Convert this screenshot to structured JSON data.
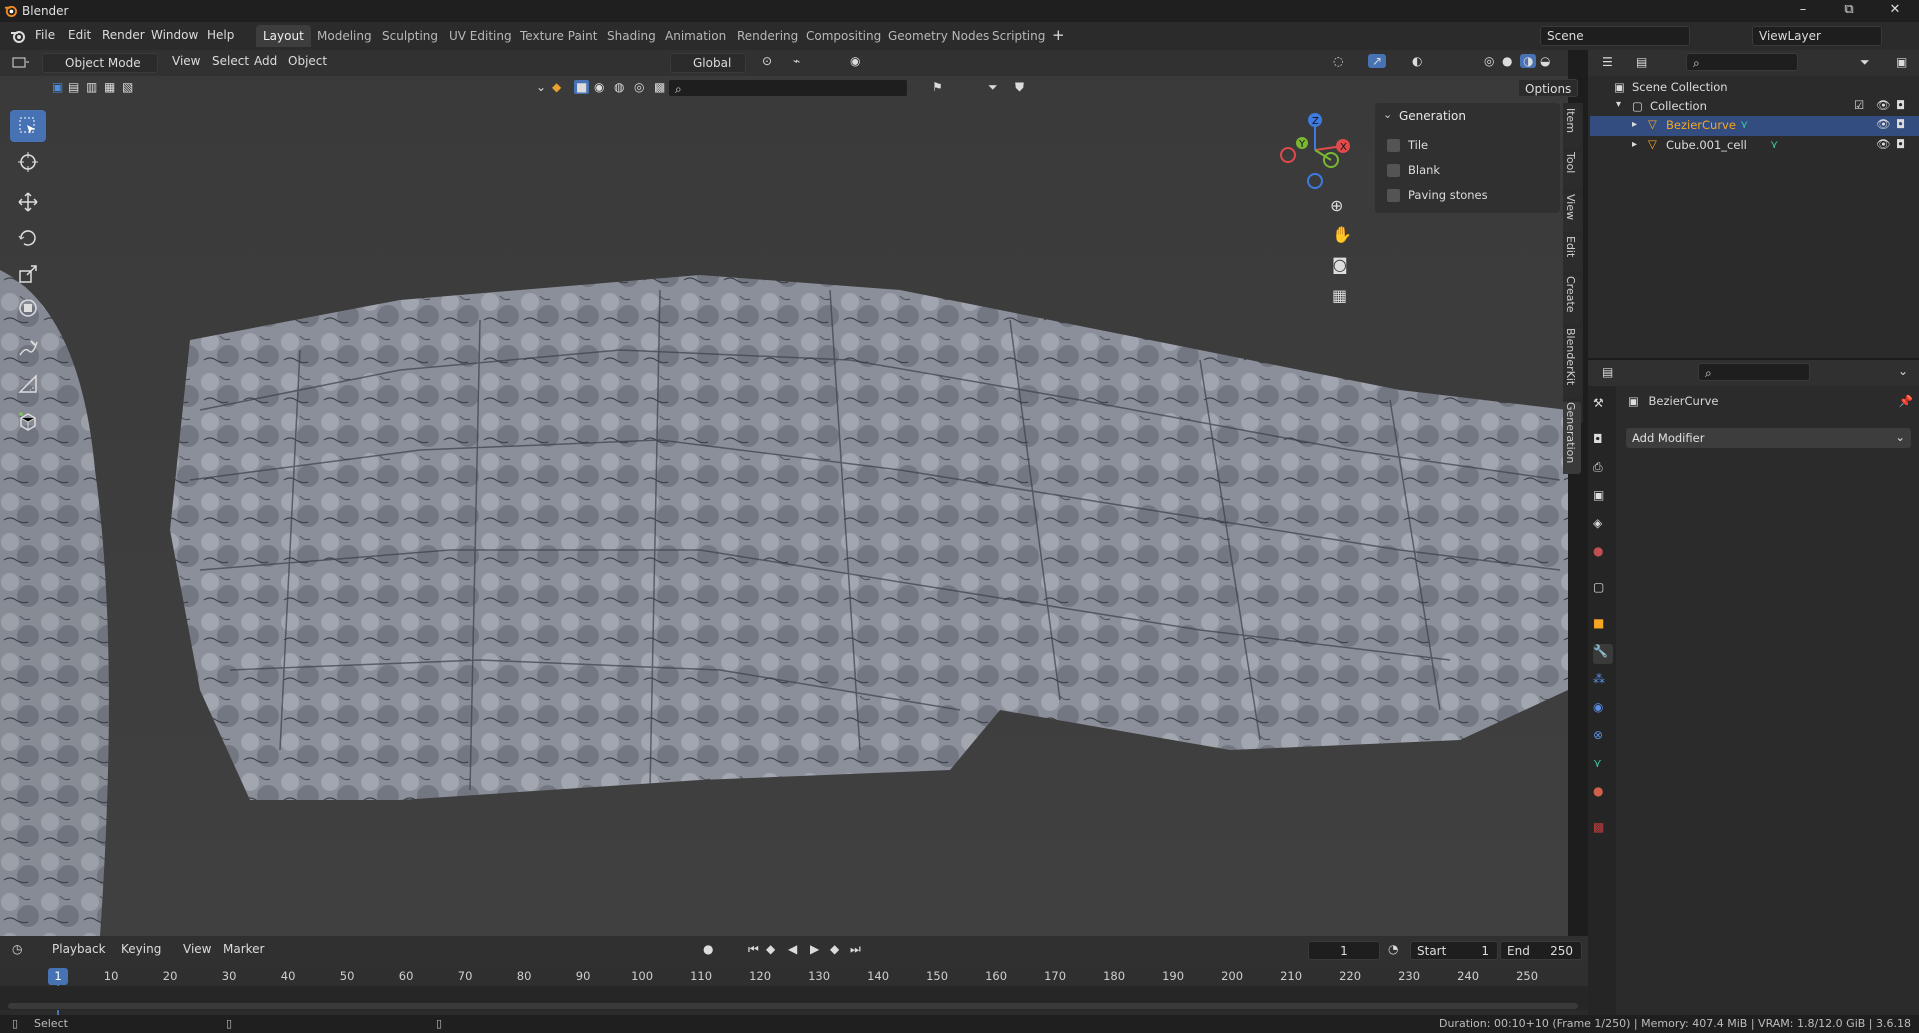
{
  "app": {
    "title": "Blender"
  },
  "window_controls": {
    "minimize": "–",
    "maximize": "⧉",
    "close": "✕"
  },
  "menu": [
    "File",
    "Edit",
    "Render",
    "Window",
    "Help"
  ],
  "workspaces": [
    "Layout",
    "Modeling",
    "Sculpting",
    "UV Editing",
    "Texture Paint",
    "Shading",
    "Animation",
    "Rendering",
    "Compositing",
    "Geometry Nodes",
    "Scripting"
  ],
  "workspace_add": "+",
  "scene": {
    "label": "Scene",
    "view_layer": "ViewLayer"
  },
  "viewport_header": {
    "mode": "Object Mode",
    "menus": [
      "View",
      "Select",
      "Add",
      "Object"
    ],
    "orientation": "Global",
    "options_label": "Options"
  },
  "n_panel": {
    "title": "Generation",
    "checkboxes": [
      {
        "label": "Tile",
        "checked": false
      },
      {
        "label": "Blank",
        "checked": false
      },
      {
        "label": "Paving stones",
        "checked": false
      }
    ]
  },
  "vertical_tabs": [
    "Item",
    "Tool",
    "View",
    "Edit",
    "Create",
    "BlenderKit",
    "Generation"
  ],
  "outliner": {
    "scene_collection": "Scene Collection",
    "collection": "Collection",
    "objects": [
      {
        "name": "BezierCurve",
        "selected": true
      },
      {
        "name": "Cube.001_cell",
        "selected": false
      }
    ]
  },
  "properties": {
    "object_name": "BezierCurve",
    "add_modifier": "Add Modifier"
  },
  "timeline": {
    "menus": [
      "Playback",
      "Keying",
      "View",
      "Marker"
    ],
    "current_frame": "1",
    "start_label": "Start",
    "start": "1",
    "end_label": "End",
    "end": "250",
    "ticks": [
      "1",
      "10",
      "20",
      "30",
      "40",
      "50",
      "60",
      "70",
      "80",
      "90",
      "100",
      "110",
      "120",
      "130",
      "140",
      "150",
      "160",
      "170",
      "180",
      "190",
      "200",
      "210",
      "220",
      "230",
      "240",
      "250"
    ]
  },
  "status": {
    "left": "Select",
    "right": "Duration: 00:10+10 (Frame 1/250) | Memory: 407.4 MiB | VRAM: 1.8/12.0 GiB | 3.6.18"
  },
  "colors": {
    "accent": "#4772b3",
    "selected_row": "#334d80",
    "highlight_text": "#f5a623"
  }
}
